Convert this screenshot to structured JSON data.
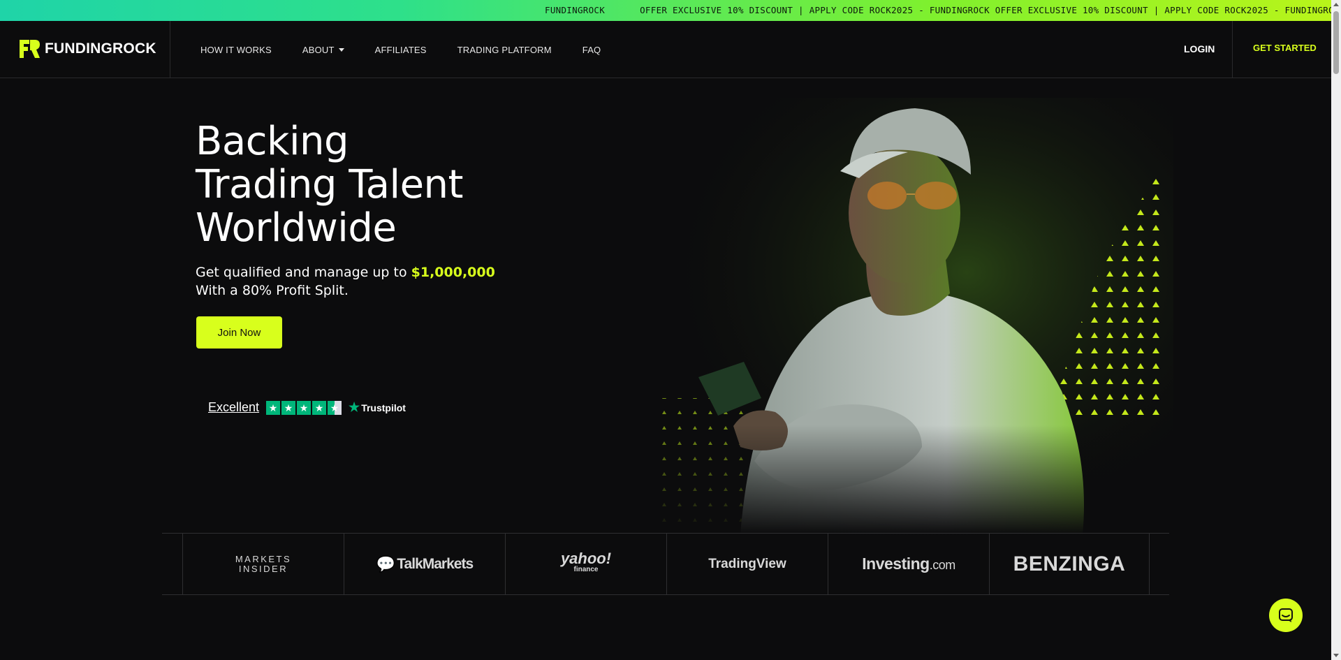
{
  "promo": {
    "items": [
      "FUNDINGROCK",
      "OFFER EXCLUSIVE 10% DISCOUNT | APPLY CODE ROCK2025 - FUNDINGROCK OFFER EXCLUSIVE 10% DISCOUNT | APPLY CODE ROCK2025 - FUNDINGROCK"
    ]
  },
  "header": {
    "brand": "FUNDINGROCK",
    "nav": [
      "HOW IT WORKS",
      "ABOUT",
      "AFFILIATES",
      "TRADING PLATFORM",
      "FAQ"
    ],
    "login": "LOGIN",
    "get_started": "GET STARTED"
  },
  "hero": {
    "title_lines": [
      "Backing",
      "Trading Talent",
      "Worldwide"
    ],
    "sub_prefix": "Get qualified and manage up to ",
    "sub_amount": "$1,000,000",
    "sub_line2": "With a 80% Profit Split.",
    "cta": "Join Now"
  },
  "trustpilot": {
    "rating_text": "Excellent",
    "stars": 4.5,
    "brand": "Trustpilot"
  },
  "press": {
    "markets_insider": [
      "MARKETS",
      "INSIDER"
    ],
    "talkmarkets": "TalkMarkets",
    "yahoo": "yahoo!",
    "yahoo_sub": "finance",
    "tradingview": "TradingView",
    "investing": "Investing",
    "investing_suffix": ".com",
    "benzinga": "BENZINGA"
  },
  "colors": {
    "accent": "#d8ff1c",
    "background": "#0c0c0d",
    "trustpilot_green": "#00b67a"
  },
  "icons": {
    "logo": "fundingrock-logo-icon",
    "chat": "chat-bubble-icon",
    "caret": "chevron-down-icon"
  }
}
